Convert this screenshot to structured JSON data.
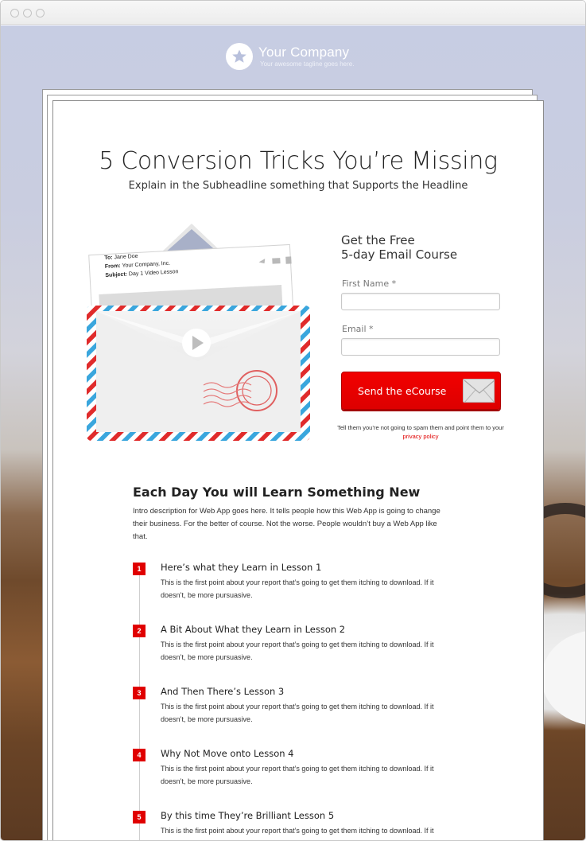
{
  "header": {
    "company_name": "Your Company",
    "tagline": "Your awesome tagline goes here."
  },
  "hero": {
    "headline": "5 Conversion Tricks You’re Missing",
    "subheadline": "Explain in the Subheadline something that Supports the Headline"
  },
  "email_preview": {
    "to_label": "To:",
    "to_value": "Jane Doe",
    "from_label": "From:",
    "from_value": "Your Company, Inc.",
    "subject_label": "Subject:",
    "subject_value": "Day 1 Video Lesson"
  },
  "form": {
    "title_line1": "Get the Free",
    "title_line2": "5-day Email Course",
    "first_name_label": "First Name *",
    "first_name_value": "",
    "email_label": "Email *",
    "email_value": "",
    "submit_label": "Send the eCourse",
    "spam_note": "Tell them you’re not going to spam them and point them to your",
    "privacy_link": "privacy policy"
  },
  "learn": {
    "title": "Each Day You will Learn Something New",
    "intro": "Intro description for Web App goes here. It tells people how this Web App is going to change their business. For the better of course. Not the worse. People wouldn’t buy a Web App like that.",
    "lessons": [
      {
        "number": "1",
        "title": "Here’s what they Learn in Lesson 1",
        "body": "This is the first point about your report that’s going to get them itching to download. If it doesn’t, be more pursuasive."
      },
      {
        "number": "2",
        "title": "A Bit About What they Learn in Lesson 2",
        "body": "This is the first point about your report that’s going to get them itching to download. If it doesn’t, be more pursuasive."
      },
      {
        "number": "3",
        "title": "And Then There’s Lesson 3",
        "body": "This is the first point about your report that’s going to get them itching to download. If it doesn’t, be more pursuasive."
      },
      {
        "number": "4",
        "title": "Why Not Move onto Lesson 4",
        "body": "This is the first point about your report that’s going to get them itching to download. If it doesn’t, be more pursuasive."
      },
      {
        "number": "5",
        "title": "By this time They’re Brilliant Lesson 5",
        "body": "This is the first point about your report that’s going to get them itching to download. If it doesn’t, be more pursuasive."
      }
    ]
  },
  "colors": {
    "accent": "#e00000",
    "text": "#222222"
  }
}
